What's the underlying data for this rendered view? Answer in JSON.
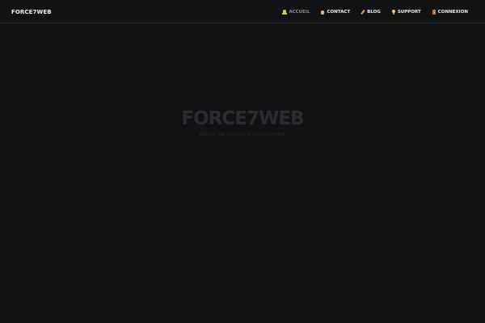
{
  "header": {
    "brand": "FORCE7WEB",
    "nav": [
      {
        "label": "ACCUEIL",
        "icon": "bell-icon",
        "active": true
      },
      {
        "label": "CONTACT",
        "icon": "hand-icon",
        "active": false
      },
      {
        "label": "BLOG",
        "icon": "pencil-icon",
        "active": false
      },
      {
        "label": "SUPPORT",
        "icon": "bulb-icon",
        "active": false
      },
      {
        "label": "CONNEXION",
        "icon": "door-icon",
        "active": false
      }
    ]
  },
  "hero": {
    "title": "FORCE7WEB",
    "subtitle": "Éditeur de logiciels d'encaissement"
  },
  "colors": {
    "background": "#111214",
    "nav_text": "#f0f0f0",
    "nav_active": "#8c8d90",
    "hero_title": "#2c2d31"
  }
}
